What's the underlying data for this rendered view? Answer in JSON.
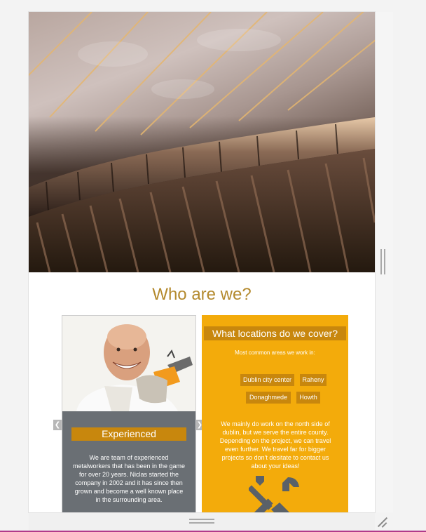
{
  "section": {
    "heading": "Who are we?"
  },
  "cards": {
    "experienced": {
      "title": "Experienced",
      "text": "We are team of experienced metalworkers that has been in the game for over 20 years. Niclas started the company in 2002 and it has since then grown and become a well known place in the surrounding area."
    },
    "locations": {
      "title": "What locations do we cover?",
      "subtitle": "Most common areas we work in:",
      "tags": [
        "Dublin city center",
        "Raheny",
        "Donaghmede",
        "Howth"
      ],
      "text": "We mainly do work on the north side of dublin, but we serve the entire county. Depending on the project, we can travel even further. We travel far for bigger projects so don't desitate to contact us about your ideas!",
      "icon": "tools-icon"
    }
  },
  "carousel": {
    "prev_icon": "chevron-left-icon",
    "next_icon": "chevron-right-icon"
  },
  "colors": {
    "accent": "#c8870d",
    "heading": "#b48a2e",
    "card_yellow": "#f3ab0b",
    "card_gray": "#6a6f74"
  }
}
